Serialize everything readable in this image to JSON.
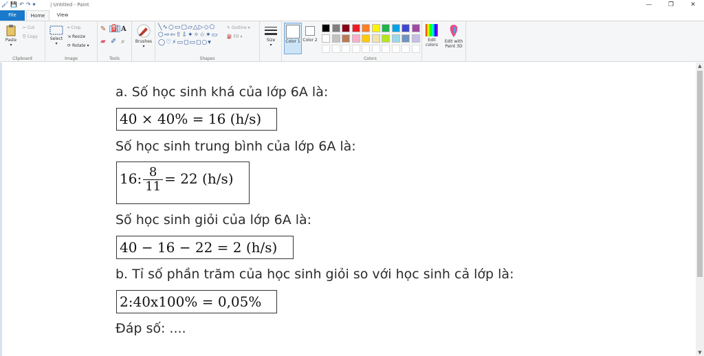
{
  "window": {
    "title": "| Untitled - Paint",
    "controls": [
      "—",
      "❐",
      "✕"
    ]
  },
  "tabs": [
    "File",
    "Home",
    "View"
  ],
  "ribbon": {
    "clipboard": {
      "label": "Clipboard",
      "paste": "Paste",
      "cut": "Cut",
      "copy": "Copy"
    },
    "image": {
      "label": "Image",
      "select": "Select",
      "crop": "Crop",
      "resize": "Resize",
      "rotate": "Rotate ▾"
    },
    "tools": {
      "label": "Tools"
    },
    "brushes": {
      "label": "Brushes"
    },
    "shapes": {
      "label": "Shapes",
      "outline": "Outline ▾",
      "fill": "Fill ▾"
    },
    "size": {
      "label": "Size"
    },
    "color1": {
      "label": "Color 1"
    },
    "color2": {
      "label": "Color 2"
    },
    "colors": {
      "label": "Colors",
      "row1": [
        "#000000",
        "#7f7f7f",
        "#880015",
        "#ed1c24",
        "#ff7f27",
        "#fff200",
        "#22b14c",
        "#00a2e8",
        "#3f48cc",
        "#a349a4"
      ],
      "row2": [
        "#ffffff",
        "#c3c3c3",
        "#b97a57",
        "#ffaec9",
        "#ffc90e",
        "#efe4b0",
        "#b5e61d",
        "#99d9ea",
        "#7092be",
        "#c8bfe7"
      ]
    },
    "edit_colors": {
      "label": "Edit colors"
    },
    "paint3d": {
      "label": "Edit with Paint 3D"
    }
  },
  "document": {
    "line1": "a. Số học sinh khá của lớp 6A là:",
    "math1": "40 × 40% = 16 (h/s)",
    "line2": "Số học sinh trung bình của lớp 6A là:",
    "math2_pre": "16:",
    "math2_num": "8",
    "math2_den": "11",
    "math2_post": "= 22 (h/s)",
    "line3": "Số học sinh giỏi của lớp 6A là:",
    "math3": "40 − 16 − 22 = 2 (h/s)",
    "line4": "b. Tỉ số phần trăm của học sinh giỏi so với học sinh cả lớp là:",
    "math4": "2:40x100% = 0,05%",
    "line5": "Đáp số: ...."
  }
}
